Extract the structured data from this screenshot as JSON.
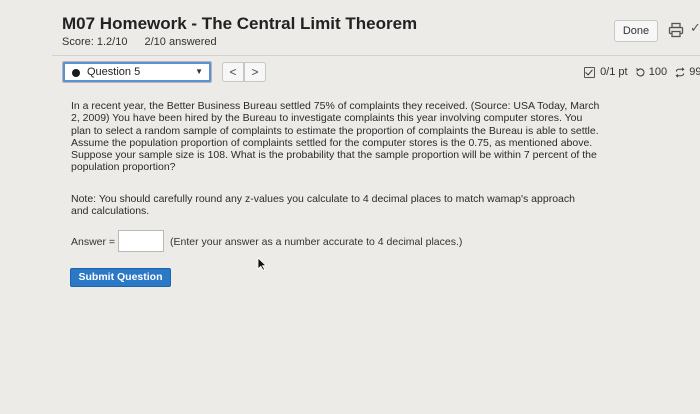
{
  "header": {
    "title": "M07 Homework - The Central Limit Theorem",
    "score": "Score: 1.2/10",
    "answered": "2/10 answered",
    "done_label": "Done"
  },
  "question_nav": {
    "selected": "Question 5",
    "prev": "<",
    "next": ">"
  },
  "points": {
    "score": "0/1 pt",
    "retries": "100",
    "submissions": "99"
  },
  "question": {
    "body": "In a recent year, the Better Business Bureau settled 75% of complaints they received. (Source: USA Today, March 2, 2009) You have been hired by the Bureau to investigate complaints this year involving computer stores. You plan to select a random sample of complaints to estimate the proportion of complaints the Bureau is able to settle. Assume the population proportion of complaints settled for the computer stores is the 0.75, as mentioned above. Suppose your sample size is 108. What is the probability that the sample proportion will be within 7 percent of the population proportion?",
    "note": "Note: You should carefully round any z-values you calculate to 4 decimal places to match wamap's approach and calculations."
  },
  "answer": {
    "label": "Answer =",
    "value": "",
    "hint": "(Enter your answer as a number accurate to 4 decimal places.)"
  },
  "submit_label": "Submit Question",
  "icons": {
    "print": "printer-icon",
    "retry": "refresh-icon",
    "submissions": "cycle-icon",
    "points": "checkbox-icon",
    "cursor": "mouse-pointer-icon"
  }
}
